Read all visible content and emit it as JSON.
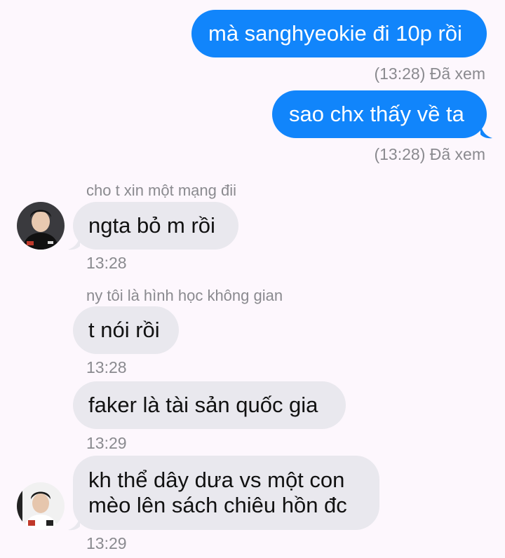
{
  "messages": {
    "out1": {
      "text": "mà sanghyeokie đi 10p rồi",
      "status": "(13:28) Đã xem"
    },
    "out2": {
      "text": "sao chx thấy về ta",
      "status": "(13:28) Đã xem"
    },
    "in1": {
      "sender": "cho t xin một mạng đii",
      "text": "ngta bỏ m rồi",
      "time": "13:28"
    },
    "in2": {
      "sender": "ny tôi là hình học không gian",
      "text": "t nói rồi",
      "time": "13:28"
    },
    "in3": {
      "text": "faker là tài sản quốc gia",
      "time": "13:29"
    },
    "in4": {
      "line1": "kh thể dây dưa vs một con",
      "line2": "mèo lên sách chiêu hồn đc",
      "time": "13:29"
    }
  },
  "colors": {
    "outgoing_bubble": "#1185fb",
    "incoming_bubble": "#e9e8ee",
    "background": "#fdf7fd",
    "meta_text": "#8a8a8f"
  },
  "icons": {
    "avatar1": "avatar-photo",
    "avatar2": "avatar-photo"
  }
}
